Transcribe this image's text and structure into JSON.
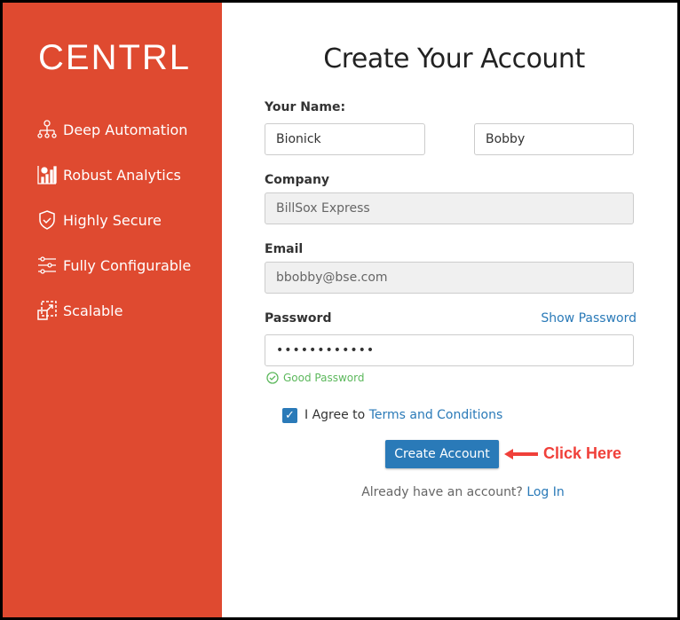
{
  "brand": "CENTRL",
  "features": [
    {
      "label": "Deep Automation",
      "icon": "automation-icon"
    },
    {
      "label": "Robust Analytics",
      "icon": "analytics-icon"
    },
    {
      "label": "Highly Secure",
      "icon": "shield-icon"
    },
    {
      "label": "Fully Configurable",
      "icon": "sliders-icon"
    },
    {
      "label": "Scalable",
      "icon": "scale-icon"
    }
  ],
  "form": {
    "title": "Create Your Account",
    "name_label": "Your Name:",
    "first_name": "Bionick",
    "last_name": "Bobby",
    "company_label": "Company",
    "company": "BillSox Express",
    "email_label": "Email",
    "email": "bbobby@bse.com",
    "password_label": "Password",
    "show_password": "Show Password",
    "password": "••••••••••••",
    "password_status": "Good Password",
    "agree_text": "I Agree to",
    "terms_link": "Terms and Conditions",
    "agree_checked": true,
    "submit": "Create Account",
    "login_prompt": "Already have an account?",
    "login_link": "Log In"
  },
  "annotation": "Click Here",
  "colors": {
    "sidebar": "#df4a30",
    "primary": "#2a7ab8",
    "success": "#5cb85c",
    "annotation": "#f0403a"
  }
}
